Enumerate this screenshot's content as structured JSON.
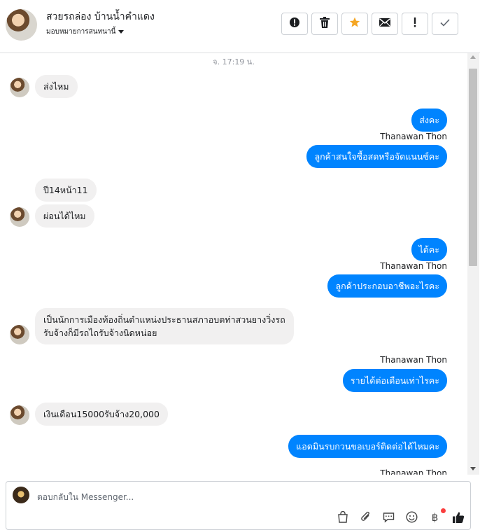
{
  "header": {
    "contact_name": "สวยรถล่อง บ้านน้ำคำแดง",
    "assign_label": "มอบหมายการสนทนานี้",
    "actions": [
      {
        "name": "spam-alert-button",
        "icon": "alert-circle-icon",
        "glyph": "●"
      },
      {
        "name": "delete-button",
        "icon": "trash-icon",
        "glyph": "🗑"
      },
      {
        "name": "star-button",
        "icon": "star-icon",
        "glyph": "★"
      },
      {
        "name": "mark-unread-button",
        "icon": "envelope-icon",
        "glyph": "✉"
      },
      {
        "name": "follow-up-button",
        "icon": "exclamation-icon",
        "glyph": "!"
      },
      {
        "name": "mark-done-button",
        "icon": "check-icon",
        "glyph": "✓"
      }
    ]
  },
  "thread": {
    "timestamp": "จ. 17:19 น.",
    "messages": [
      {
        "dir": "in",
        "text": "ส่งไหม"
      },
      {
        "dir": "out",
        "text": "ส่งคะ"
      },
      {
        "sender": "Thanawan Thon"
      },
      {
        "dir": "out",
        "text": "ลูกค้าสนใจซื้อสดหรือจัดแนนซ์คะ"
      },
      {
        "dir": "in",
        "text": "ปี14หน้า11"
      },
      {
        "dir": "in",
        "text": "ผ่อนได้ไหม"
      },
      {
        "dir": "out",
        "text": "ได้คะ"
      },
      {
        "sender": "Thanawan Thon"
      },
      {
        "dir": "out",
        "text": "ลูกค้าประกอบอาชีพอะไรคะ"
      },
      {
        "dir": "in",
        "text": "เป็นนักการเมืองท้องถิ่นตำแหน่งประธานสภาอบตท่าสวนยางวิ่งรถ"
      },
      {
        "dir": "in",
        "text": "รับจ้างก็มีรถไถรับจ้างนิดหน่อย"
      },
      {
        "sender": "Thanawan Thon"
      },
      {
        "dir": "out",
        "text": "รายได้ต่อเดือนเท่าไรคะ"
      },
      {
        "dir": "in",
        "text": "เงินเดือน15000รับจ้าง20,000"
      },
      {
        "dir": "out",
        "text": "แอดมินรบกวนขอเบอร์ติดต่อได้ไหมคะ"
      },
      {
        "sender": "Thanawan Thon"
      }
    ]
  },
  "composer": {
    "placeholder": "ตอบกลับใน Messenger..."
  },
  "toolbar": {
    "tools": [
      {
        "name": "shopping-bag-icon",
        "glyph": "👜"
      },
      {
        "name": "paperclip-icon",
        "glyph": "📎"
      },
      {
        "name": "saved-reply-icon",
        "glyph": "💬"
      },
      {
        "name": "emoji-icon",
        "glyph": "☺"
      },
      {
        "name": "payment-baht-icon",
        "glyph": "฿"
      },
      {
        "name": "like-icon",
        "glyph": "👍"
      }
    ]
  },
  "colors": {
    "outgoing_bubble": "#0084ff",
    "incoming_bubble": "#f1f0f0",
    "notification_dot": "#fa3e3e"
  }
}
